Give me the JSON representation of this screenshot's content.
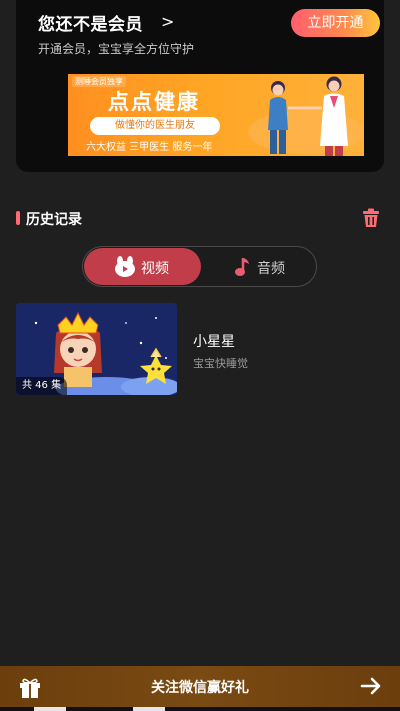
{
  "vip": {
    "title": "您还不是会员",
    "chevron": ">",
    "subtitle": "开通会员，宝宝享全方位守护",
    "open_button": "立即开通"
  },
  "banner": {
    "tag": "测睡会员独享",
    "title": "点点健康",
    "pill": "做懂你的医生朋友",
    "footer": "六大权益 三甲医生 服务一年"
  },
  "history": {
    "title": "历史记录",
    "trash_icon": "trash-icon"
  },
  "tabs": {
    "video_label": "视频",
    "audio_label": "音频",
    "active": "video",
    "active_color": "#c13d4a"
  },
  "items": [
    {
      "title": "小星星",
      "subtitle": "宝宝快睡觉",
      "episodes": "共 46 集"
    }
  ],
  "bottom": {
    "text": "关注微信赢好礼",
    "gift_icon": "gift-icon",
    "arrow_icon": "arrow-right-icon"
  },
  "colors": {
    "accent": "#ff6b72",
    "background": "#1f1f1f"
  }
}
